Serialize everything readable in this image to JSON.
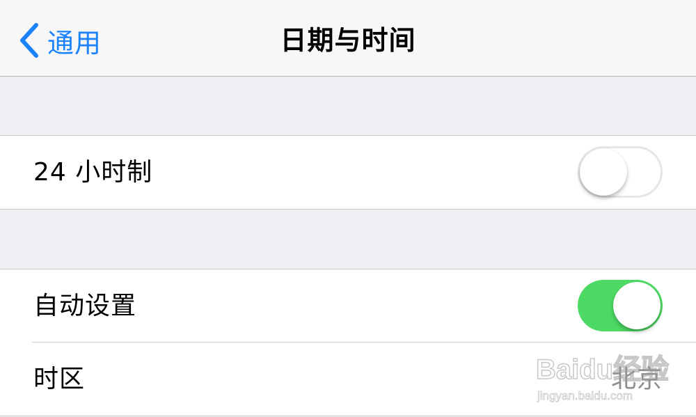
{
  "navbar": {
    "back_label": "通用",
    "title": "日期与时间"
  },
  "groups": [
    {
      "rows": [
        {
          "label": "24 小时制",
          "toggle": "off"
        }
      ]
    },
    {
      "rows": [
        {
          "label": "自动设置",
          "toggle": "on"
        },
        {
          "label": "时区",
          "value": "北京"
        }
      ]
    }
  ],
  "colors": {
    "accent": "#1a82fb",
    "toggle_on": "#4cd964",
    "background": "#efeff4"
  },
  "watermark": {
    "text": "Baidu经验",
    "url": "jingyan.baidu.com"
  }
}
